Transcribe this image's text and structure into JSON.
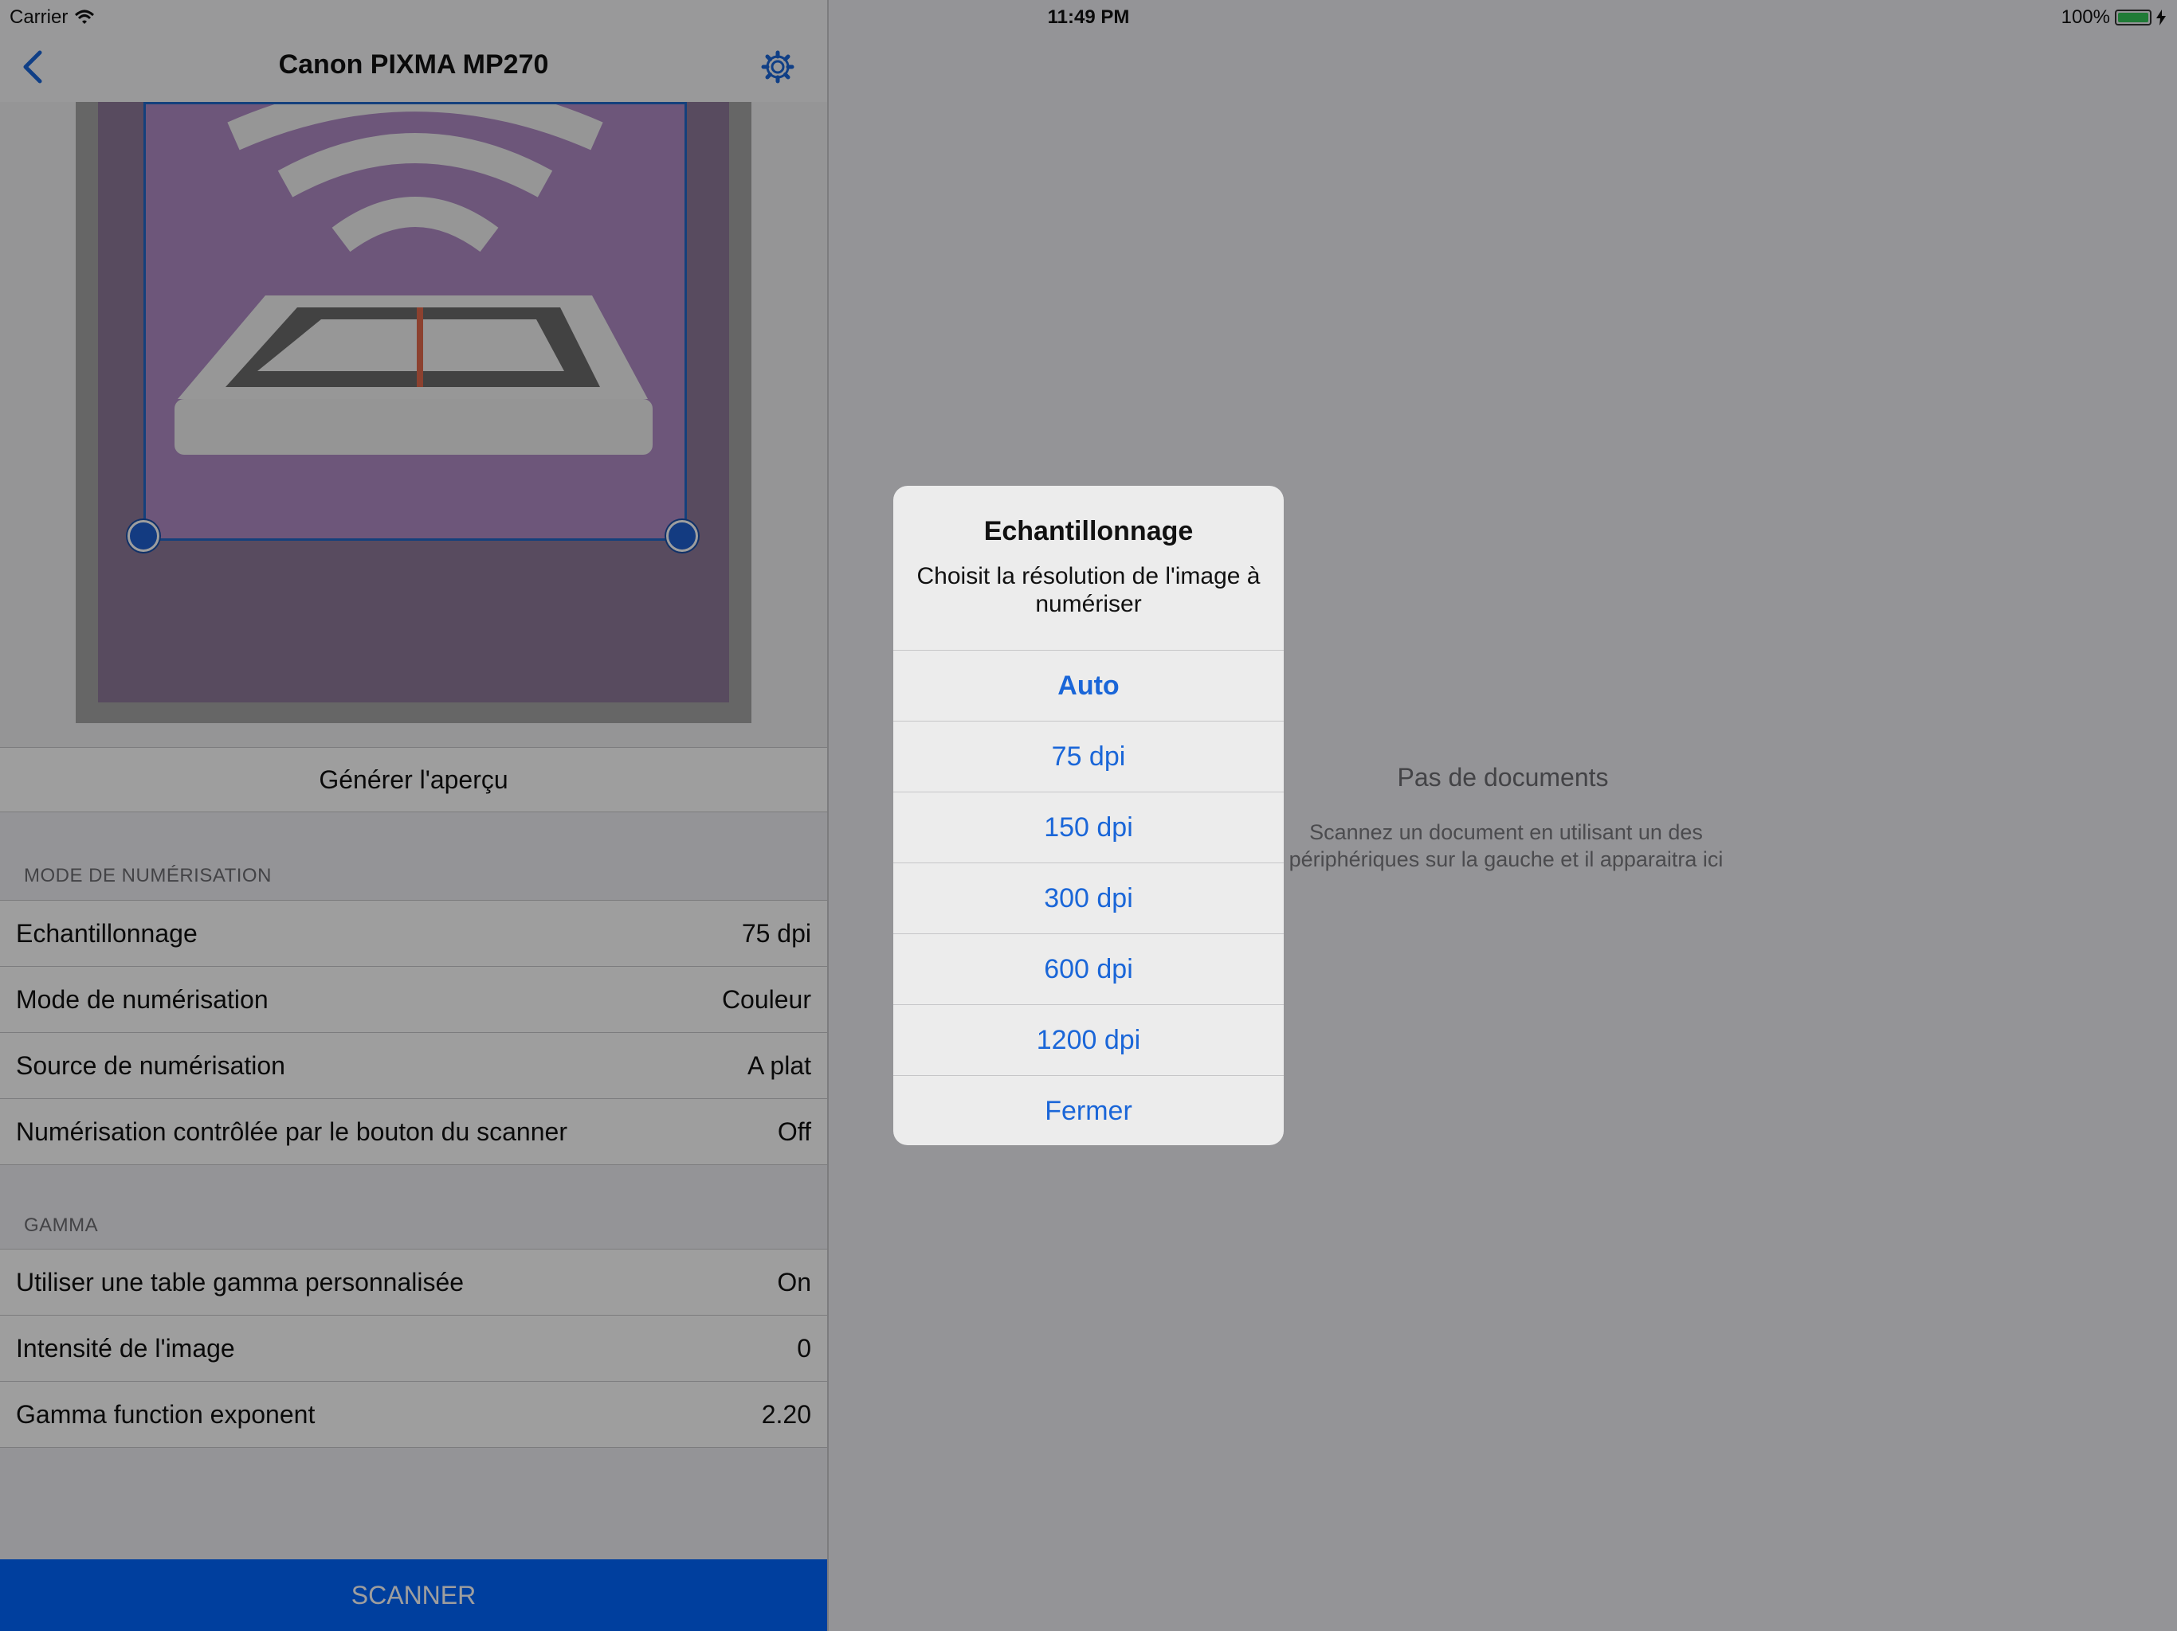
{
  "status_bar": {
    "carrier": "Carrier",
    "time": "11:49 PM",
    "battery": "100%"
  },
  "navbar": {
    "title": "Canon PIXMA MP270"
  },
  "preview": {
    "generate_label": "Générer l'aperçu"
  },
  "scan_mode": {
    "header": "MODE DE NUMÉRISATION",
    "rows": [
      {
        "label": "Echantillonnage",
        "value": "75 dpi"
      },
      {
        "label": "Mode de numérisation",
        "value": "Couleur"
      },
      {
        "label": "Source de numérisation",
        "value": "A plat"
      },
      {
        "label": "Numérisation contrôlée par le bouton du scanner",
        "value": "Off"
      }
    ]
  },
  "gamma": {
    "header": "GAMMA",
    "rows": [
      {
        "label": "Utiliser une table gamma personnalisée",
        "value": "On"
      },
      {
        "label": "Intensité de l'image",
        "value": "0"
      },
      {
        "label": "Gamma function exponent",
        "value": "2.20"
      }
    ]
  },
  "scan_button": "SCANNER",
  "empty_state": {
    "title": "Pas de documents",
    "subtitle": "Scannez un document en utilisant un des périphériques sur la gauche et il apparaitra ici"
  },
  "alert": {
    "title": "Echantillonnage",
    "message": "Choisit la résolution de l'image à numériser",
    "options": [
      "Auto",
      "75 dpi",
      "150 dpi",
      "300 dpi",
      "600 dpi",
      "1200 dpi",
      "Fermer"
    ]
  },
  "colors": {
    "accent": "#1a66d8",
    "scan_button": "#0066ff",
    "background": "#efeff4"
  }
}
